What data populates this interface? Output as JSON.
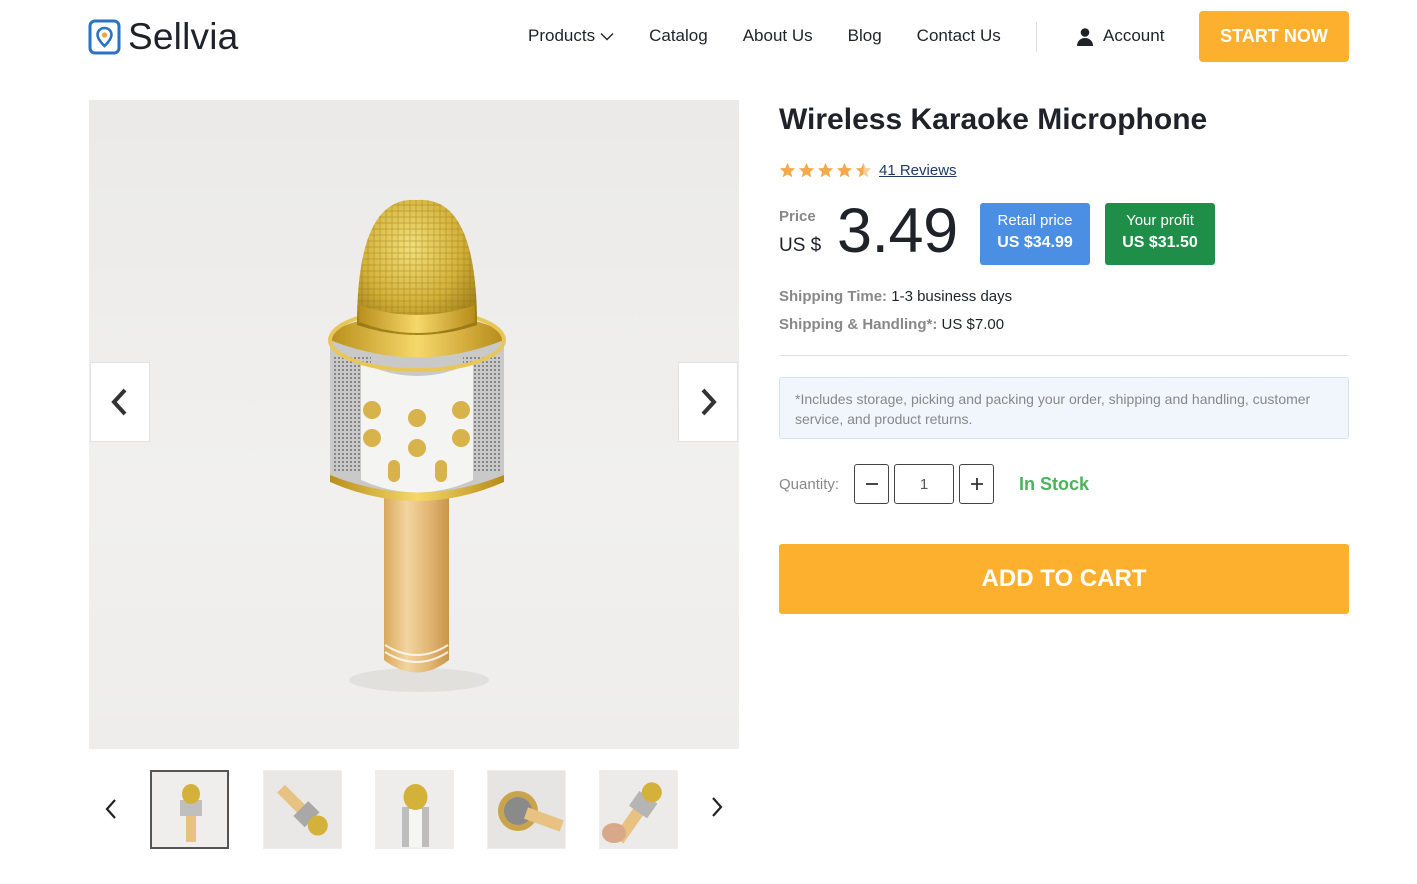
{
  "header": {
    "brand": "Sellvia",
    "nav": [
      {
        "label": "Products",
        "has_dropdown": true
      },
      {
        "label": "Catalog"
      },
      {
        "label": "About Us"
      },
      {
        "label": "Blog"
      },
      {
        "label": "Contact Us"
      }
    ],
    "account_label": "Account",
    "cta_label": "START NOW",
    "icons": {
      "logo": "location-pin-logo-icon",
      "account": "user-icon",
      "dropdown": "chevron-down-icon"
    }
  },
  "gallery": {
    "thumbnail_count": 5,
    "active_index": 0,
    "icons": {
      "prev": "chevron-left-icon",
      "next": "chevron-right-icon"
    }
  },
  "product": {
    "title": "Wireless Karaoke Microphone",
    "rating": 4.5,
    "reviews_label": "41 Reviews",
    "price_label": "Price",
    "currency": "US $",
    "price": "3.49",
    "retail_label": "Retail price",
    "retail_value": "US $34.99",
    "profit_label": "Your profit",
    "profit_value": "US $31.50",
    "shipping_time_label": "Shipping Time:",
    "shipping_time_value": "1-3 business days",
    "handling_label": "Shipping & Handling*:",
    "handling_value": "US $7.00",
    "note": "*Includes storage, picking and packing your order, shipping and handling, customer service, and product returns.",
    "quantity_label": "Quantity:",
    "quantity": "1",
    "stock_status": "In Stock",
    "add_to_cart_label": "ADD TO CART"
  },
  "colors": {
    "accent_orange": "#fdb02d",
    "retail_blue": "#4a8fe4",
    "profit_green": "#1f8e48",
    "stock_green": "#4bb35a",
    "star_orange": "#f5a94a"
  }
}
